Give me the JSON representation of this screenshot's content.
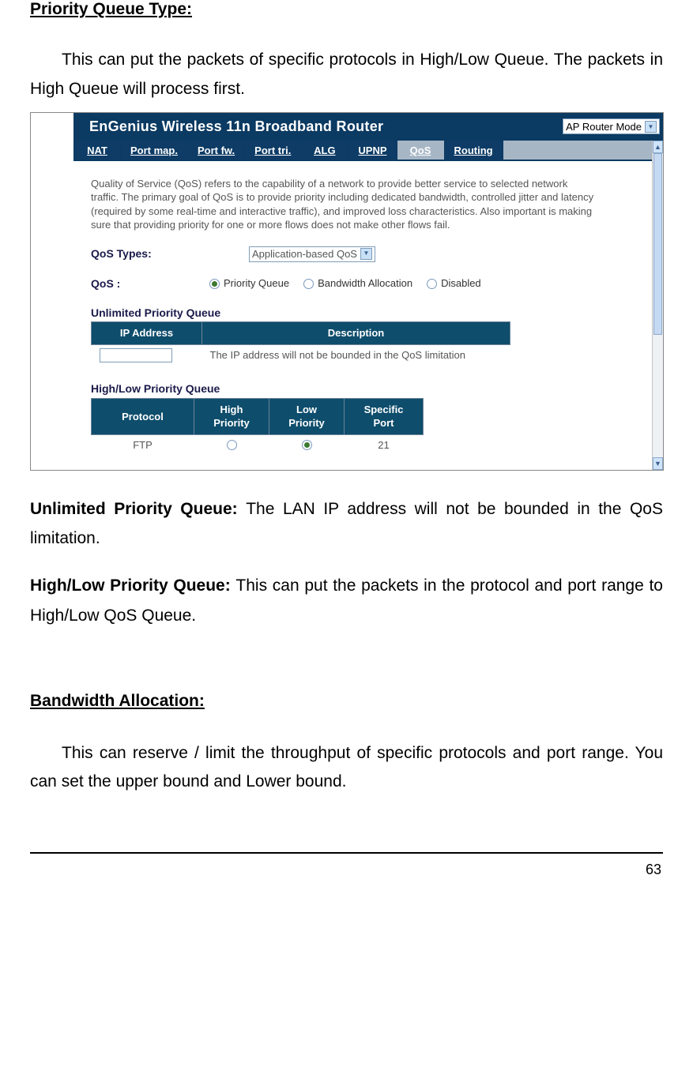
{
  "section1_title": "Priority Queue Type:",
  "para1": "This can put the packets of specific protocols in High/Low Queue. The packets in High Queue will process first.",
  "router": {
    "title": "EnGenius Wireless 11n Broadband Router",
    "mode_select": "AP Router Mode",
    "tabs": [
      "NAT",
      "Port map.",
      "Port fw.",
      "Port tri.",
      "ALG",
      "UPNP",
      "QoS",
      "Routing"
    ],
    "active_tab": "QoS",
    "intro": "Quality of Service (QoS) refers to the capability of a network to provide better service to selected network traffic. The primary goal of QoS is to provide priority including dedicated bandwidth, controlled jitter and latency (required by some real-time and interactive traffic), and improved loss characteristics. Also important is making sure that providing priority for one or more flows does not make other flows fail.",
    "qos_types_label": "QoS Types:",
    "qos_types_value": "Application-based QoS",
    "qos_label": "QoS :",
    "qos_options": [
      "Priority Queue",
      "Bandwidth Allocation",
      "Disabled"
    ],
    "qos_selected": "Priority Queue",
    "upq_heading": "Unlimited Priority Queue",
    "upq_headers": [
      "IP Address",
      "Description"
    ],
    "upq_desc": "The IP address will not be bounded in the QoS limitation",
    "hlpq_heading": "High/Low Priority Queue",
    "hlpq_headers": [
      "Protocol",
      "High Priority",
      "Low Priority",
      "Specific Port"
    ],
    "hlpq_row": {
      "protocol": "FTP",
      "high": false,
      "low": true,
      "port": "21"
    }
  },
  "def1_label": "Unlimited Priority Queue: ",
  "def1_text": "The LAN IP address will not be bounded in the QoS limitation.",
  "def2_label": "High/Low Priority Queue: ",
  "def2_text": "This can put the packets in the protocol and port range to High/Low QoS Queue.",
  "section2_title": "Bandwidth Allocation:",
  "para2": "This can reserve / limit the throughput of specific protocols and port range. You can set the upper bound and Lower bound.",
  "page_number": "63"
}
